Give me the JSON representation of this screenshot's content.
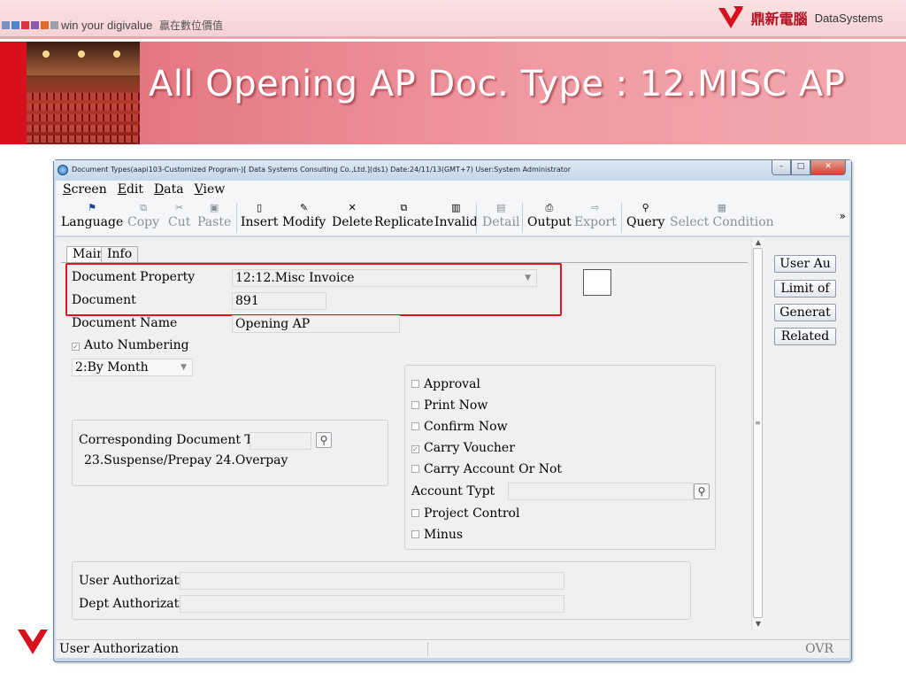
{
  "slide": {
    "tagline": "win your digivalue",
    "tagline_cn": "贏在數位價值",
    "brand_cn": "鼎新電腦",
    "brand_en": "DataSystems",
    "title": "All Opening AP Doc. Type : 12.MISC AP",
    "colors": {
      "accent_red": "#d8101e",
      "title_band": "#f09aa3"
    }
  },
  "window": {
    "title": "Document Types(aapi103-Customized Program-)[ Data Systems Consulting Co.,Ltd.](ds1)  Date:24/11/13(GMT+7)  User:System Administrator",
    "menu": [
      {
        "label": "Screen",
        "hotkey": "S"
      },
      {
        "label": "Edit",
        "hotkey": "E"
      },
      {
        "label": "Data",
        "hotkey": "D"
      },
      {
        "label": "View",
        "hotkey": "V"
      }
    ],
    "toolbar": [
      {
        "label": "Language",
        "icon": "flag-icon",
        "glyph": "⚑",
        "enabled": true
      },
      {
        "label": "Copy",
        "icon": "copy-icon",
        "glyph": "⧉",
        "enabled": false
      },
      {
        "label": "Cut",
        "icon": "scissors-icon",
        "glyph": "✂",
        "enabled": false
      },
      {
        "label": "Paste",
        "icon": "paste-icon",
        "glyph": "▣",
        "enabled": false
      },
      {
        "label": "Insert",
        "icon": "new-doc-icon",
        "glyph": "▯",
        "enabled": true
      },
      {
        "label": "Modify",
        "icon": "pencil-icon",
        "glyph": "✎",
        "enabled": true
      },
      {
        "label": "Delete",
        "icon": "delete-x-icon",
        "glyph": "✕",
        "enabled": true
      },
      {
        "label": "Replicate",
        "icon": "replicate-icon",
        "glyph": "⧉",
        "enabled": true
      },
      {
        "label": "Invalid",
        "icon": "trash-icon",
        "glyph": "▥",
        "enabled": true
      },
      {
        "label": "Detail",
        "icon": "detail-icon",
        "glyph": "▤",
        "enabled": false
      },
      {
        "label": "Output",
        "icon": "printer-icon",
        "glyph": "⎙",
        "enabled": true
      },
      {
        "label": "Export",
        "icon": "export-icon",
        "glyph": "⇨",
        "enabled": false
      },
      {
        "label": "Query",
        "icon": "binoculars-icon",
        "glyph": "⚲",
        "enabled": true
      },
      {
        "label": "Select Condition",
        "icon": "filter-icon",
        "glyph": "▦",
        "enabled": false
      }
    ],
    "toolbar_more": "»",
    "tabs": [
      "Main",
      "Info"
    ],
    "form": {
      "document_property_label": "Document Property",
      "document_property_value": "12:12.Misc Invoice",
      "document_label": "Document",
      "document_value": "891",
      "document_name_label": "Document Name",
      "document_name_value": "Opening AP",
      "auto_numbering_label": "Auto Numbering",
      "auto_numbering_checked": true,
      "numbering_mode": "2:By Month",
      "corresponding_label": "Corresponding Document Type",
      "corresponding_value": "",
      "corresponding_hint": "23.Suspense/Prepay 24.Overpay",
      "options": [
        {
          "label": "Approval",
          "checked": false
        },
        {
          "label": "Print Now",
          "checked": false
        },
        {
          "label": "Confirm Now",
          "checked": false
        },
        {
          "label": "Carry Voucher",
          "checked": true
        },
        {
          "label": "Carry Account Or Not",
          "checked": false
        }
      ],
      "account_type_label": "Account Typt",
      "account_type_value": "",
      "options2": [
        {
          "label": "Project Control",
          "checked": false
        },
        {
          "label": "Minus",
          "checked": false
        }
      ],
      "user_auth_label": "User Authorization",
      "user_auth_value": "",
      "dept_auth_label": "Dept Authorization",
      "dept_auth_value": ""
    },
    "side_buttons": [
      "User Au",
      "Limit of",
      "Generat",
      "Related"
    ],
    "status": {
      "text": "User Authorization",
      "mode": "OVR"
    }
  }
}
